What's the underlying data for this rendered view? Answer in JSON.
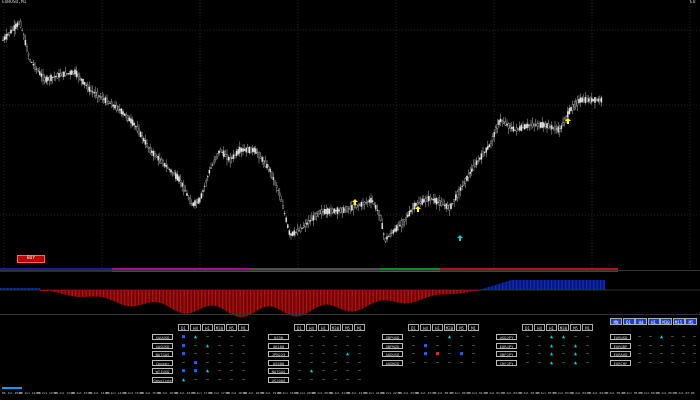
{
  "symbol_label": "EU",
  "top_info": "EURUSD,M1",
  "buy_button": "BUY",
  "tf_headers": [
    "D1",
    "H4",
    "H1",
    "M30",
    "M5",
    "M1"
  ],
  "groups": [
    {
      "symbols": [
        "XAUUSD",
        "XAGUSD",
        "NATGAS",
        "Copper",
        "WTIUSD",
        "Gasoline"
      ],
      "rows": [
        [
          "dn",
          "up",
          "dh",
          "dh",
          "dh",
          "dh"
        ],
        [
          "dn",
          "dh",
          "up",
          "dh",
          "dh",
          "dh"
        ],
        [
          "dn",
          "dh",
          "dh",
          "dh",
          "dh",
          "dh"
        ],
        [
          "dh",
          "dn",
          "dh",
          "dh",
          "dh",
          "dh"
        ],
        [
          "dn",
          "dn",
          "up",
          "dh",
          "dh",
          "dh"
        ],
        [
          "up",
          "dh",
          "dh",
          "dh",
          "dh",
          "dh"
        ]
      ]
    },
    {
      "symbols": [
        "US30",
        "UK100",
        "JPN225",
        "US500",
        "NATGAS",
        "US2000"
      ],
      "rows": [
        [
          "dh",
          "dh",
          "dh",
          "dh",
          "dh",
          "dh"
        ],
        [
          "dh",
          "dh",
          "dh",
          "dh",
          "dh",
          "dh"
        ],
        [
          "dh",
          "dh",
          "dh",
          "dh",
          "up",
          "dh"
        ],
        [
          "dh",
          "dh",
          "dh",
          "dh",
          "dh",
          "dh"
        ],
        [
          "dh",
          "up",
          "dh",
          "dh",
          "dh",
          "dh"
        ],
        [
          "dh",
          "dh",
          "dh",
          "dh",
          "dh",
          "dh"
        ]
      ]
    },
    {
      "symbols": [
        "GBPUSD",
        "GBPNZD",
        "AUDUSD",
        "AUDNZD"
      ],
      "rows": [
        [
          "dh",
          "dh",
          "dh",
          "up",
          "dh",
          "dh"
        ],
        [
          "dh",
          "dn",
          "dh",
          "dh",
          "dh",
          "dh"
        ],
        [
          "dh",
          "dn",
          "sq",
          "dh",
          "dn",
          "dh"
        ],
        [
          "dh",
          "dh",
          "dh",
          "dh",
          "dh",
          "dh"
        ]
      ]
    },
    {
      "symbols": [
        "USDJPY",
        "EURJPY",
        "GBPJPY",
        "CHFJPY"
      ],
      "rows": [
        [
          "dh",
          "dh",
          "up",
          "up",
          "dh",
          "dh"
        ],
        [
          "dh",
          "dh",
          "up",
          "dh",
          "up",
          "dh"
        ],
        [
          "dh",
          "dh",
          "up",
          "dh",
          "up",
          "dh"
        ],
        [
          "dh",
          "dh",
          "up",
          "dh",
          "up",
          "dh"
        ]
      ]
    }
  ],
  "right_headers": [
    "MN",
    "D1",
    "H4",
    "H1",
    "M30",
    "M15",
    "M5"
  ],
  "right_symbols": [
    "EURUSD",
    "EURGBP",
    "EURAUD",
    "EURCHF"
  ],
  "right_rows": [
    [
      "dh",
      "dh",
      "up",
      "dh",
      "dh",
      "dh",
      "dh"
    ],
    [
      "dh",
      "dh",
      "dh",
      "dh",
      "dh",
      "dh",
      "up"
    ],
    [
      "dh",
      "dh",
      "dh",
      "dh",
      "dh",
      "dh",
      "dh"
    ],
    [
      "dh",
      "dh",
      "dh",
      "dh",
      "dh",
      "dh",
      "up"
    ]
  ],
  "time_labels": [
    "06 Jul 2018",
    "06 Jul 12:00",
    "06 Jul 12:30",
    "06 Jul 13:00",
    "06 Jul 13:30",
    "06 Jul 14:00",
    "06 Jul 14:30",
    "06 Jul 15:00",
    "06 Jul 15:30",
    "06 Jul 16:00",
    "06 Jul 16:30",
    "06 Jul 17:00",
    "06 Jul 17:30",
    "06 Jul 18:00",
    "06 Jul 18:30",
    "06 Jul 19:00",
    "06 Jul 19:30",
    "06 Jul 20:00",
    "06 Jul 20:30",
    "06 Jul 21:00",
    "06 Jul 21:30",
    "06 Jul 22:00",
    "06 Jul 22:30",
    "06 Jul 23:00",
    "06 Jul 23:30",
    "17 Jul 00:00",
    "17 Jul 00:30",
    "17 Jul 01:00",
    "17 Jul 01:30",
    "17 Jul 02:00",
    "17 Jul 02:30",
    "17 Jul 03:00",
    "17 Jul 03:30",
    "17 Jul 04:00",
    "17 Jul 04:30",
    "17 Jul 05:00",
    "17 Jul 05:30",
    "17 Jul 06:00",
    "17 Jul 06:30",
    "17 Jul 07:00"
  ],
  "colors": {
    "candle": "#e8e8e8",
    "buy_bg": "#c00000",
    "hist_red": "#d01010",
    "hist_blue": "#1030e0",
    "arrow_yellow": "#ffff00",
    "arrow_cyan": "#00d0d0"
  }
}
